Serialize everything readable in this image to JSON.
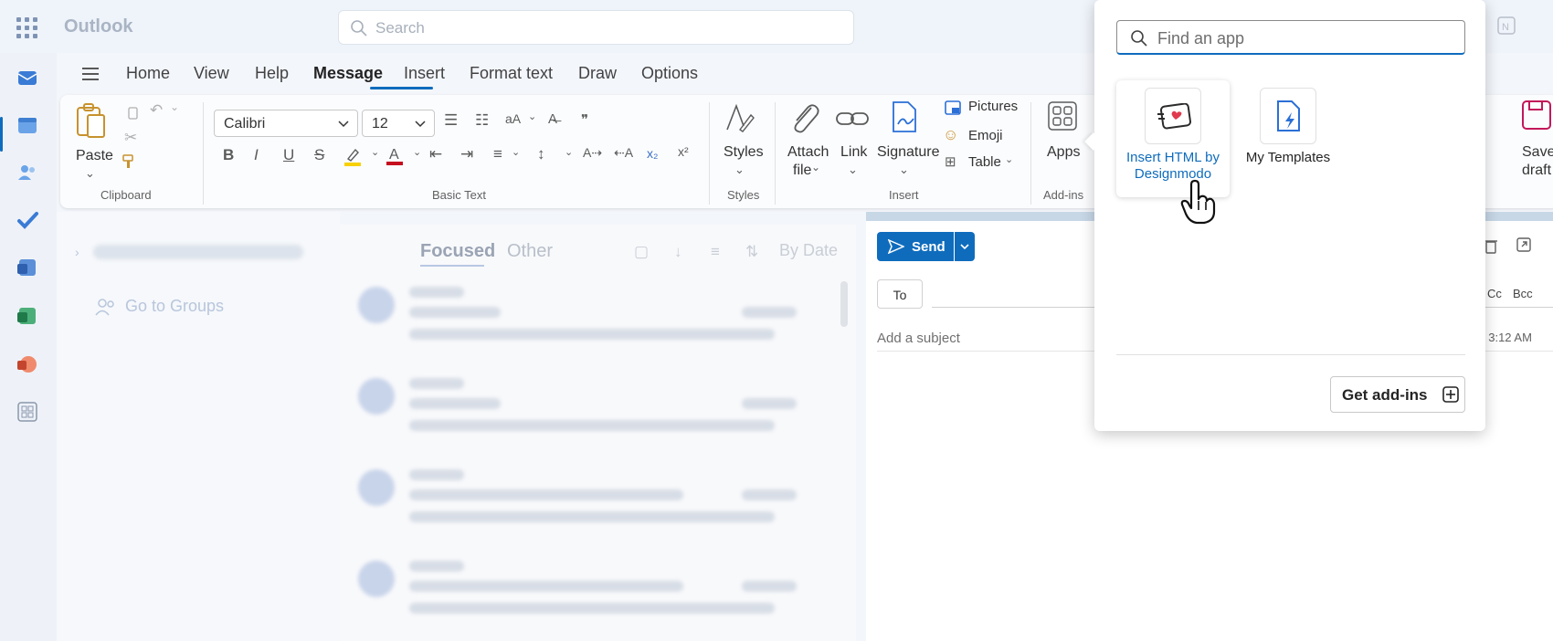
{
  "header": {
    "app_name": "Outlook",
    "search_placeholder": "Search"
  },
  "ribbon_tabs": [
    "Home",
    "View",
    "Help",
    "Message",
    "Insert",
    "Format text",
    "Draw",
    "Options"
  ],
  "active_tab": "Message",
  "clipboard": {
    "paste": "Paste",
    "group": "Clipboard"
  },
  "basic_text": {
    "font": "Calibri",
    "size": "12",
    "group": "Basic Text"
  },
  "styles": {
    "label": "Styles",
    "group": "Styles"
  },
  "insert": {
    "attach": "Attach",
    "file": "file",
    "link": "Link",
    "signature": "Signature",
    "pictures": "Pictures",
    "emoji": "Emoji",
    "table": "Table",
    "group": "Insert"
  },
  "addins": {
    "apps": "Apps",
    "group": "Add-ins"
  },
  "save": {
    "line1": "Save",
    "line2": "draft"
  },
  "folders": {
    "go_to_groups": "Go to Groups"
  },
  "message_list": {
    "focused": "Focused",
    "other": "Other",
    "sort": "By Date"
  },
  "compose": {
    "send": "Send",
    "to": "To",
    "cc": "Cc",
    "bcc": "Bcc",
    "subject_placeholder": "Add a subject",
    "time": ": 3:12 AM"
  },
  "apps_flyout": {
    "find_placeholder": "Find an app",
    "apps": [
      {
        "label_line1": "Insert HTML by",
        "label_line2": "Designmodo"
      },
      {
        "label_line1": "My Templates"
      }
    ],
    "get_addins": "Get add-ins"
  },
  "colors": {
    "accent": "#0f6cbd",
    "link": "#0f6cbd",
    "highlight": "#f7d100",
    "font_color": "#c50f1f"
  }
}
